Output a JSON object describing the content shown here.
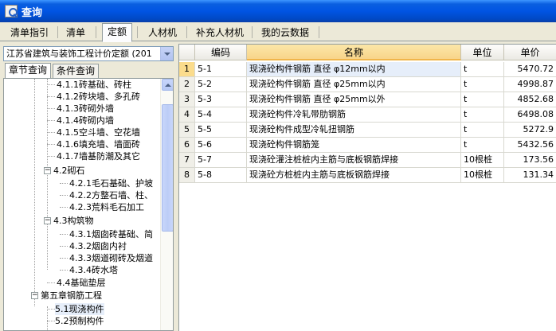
{
  "window": {
    "title": "查询"
  },
  "tabs": [
    {
      "label": "清单指引",
      "active": false
    },
    {
      "label": "清单",
      "active": false
    },
    {
      "label": "定额",
      "active": true
    },
    {
      "label": "人材机",
      "active": false
    },
    {
      "label": "补充人材机",
      "active": false
    },
    {
      "label": "我的云数据",
      "active": false
    }
  ],
  "left": {
    "library": "江苏省建筑与装饰工程计价定额 (201",
    "subtabs": [
      {
        "label": "章节查询",
        "active": true
      },
      {
        "label": "条件查询",
        "active": false
      }
    ],
    "tree": [
      {
        "label": "4.1.1砖基础、砖柱",
        "level": 3
      },
      {
        "label": "4.1.2砖块墙、多孔砖",
        "level": 3
      },
      {
        "label": "4.1.3砖砌外墙",
        "level": 3
      },
      {
        "label": "4.1.4砖砌内墙",
        "level": 3
      },
      {
        "label": "4.1.5空斗墙、空花墙",
        "level": 3
      },
      {
        "label": "4.1.6填充墙、墙面砖",
        "level": 3
      },
      {
        "label": "4.1.7墙基防潮及其它",
        "level": 3
      },
      {
        "label": "4.2砌石",
        "level": 2,
        "expander": "-"
      },
      {
        "label": "4.2.1毛石基础、护坡",
        "level": 3
      },
      {
        "label": "4.2.2方整石墙、柱、",
        "level": 3
      },
      {
        "label": "4.2.3荒料毛石加工",
        "level": 3
      },
      {
        "label": "4.3构筑物",
        "level": 2,
        "expander": "-"
      },
      {
        "label": "4.3.1烟囱砖基础、简",
        "level": 3
      },
      {
        "label": "4.3.2烟囱内衬",
        "level": 3
      },
      {
        "label": "4.3.3烟道砌砖及烟道",
        "level": 3
      },
      {
        "label": "4.3.4砖水塔",
        "level": 3
      },
      {
        "label": "4.4基础垫层",
        "level": 2
      },
      {
        "label": "第五章钢筋工程",
        "level": 1,
        "expander": "-"
      },
      {
        "label": "5.1现浇构件",
        "level": 2,
        "selected": true
      },
      {
        "label": "5.2预制构件",
        "level": 2
      }
    ]
  },
  "grid": {
    "columns": [
      "",
      "编码",
      "名称",
      "单位",
      "单价"
    ],
    "rows": [
      {
        "no": "1",
        "code": "5-1",
        "name": "现浇砼构件钢筋 直径 φ12mm以内",
        "unit": "t",
        "price": "5470.72"
      },
      {
        "no": "2",
        "code": "5-2",
        "name": "现浇砼构件钢筋 直径 φ25mm以内",
        "unit": "t",
        "price": "4998.87"
      },
      {
        "no": "3",
        "code": "5-3",
        "name": "现浇砼构件钢筋 直径 φ25mm以外",
        "unit": "t",
        "price": "4852.68"
      },
      {
        "no": "4",
        "code": "5-4",
        "name": "现浇砼构件冷轧带肋钢筋",
        "unit": "t",
        "price": "6498.08"
      },
      {
        "no": "5",
        "code": "5-5",
        "name": "现浇砼构件成型冷轧扭钢筋",
        "unit": "t",
        "price": "5272.9"
      },
      {
        "no": "6",
        "code": "5-6",
        "name": "现浇砼构件钢筋笼",
        "unit": "t",
        "price": "5432.56"
      },
      {
        "no": "7",
        "code": "5-7",
        "name": "现浇砼灌注桩桩内主筋与底板钢筋焊接",
        "unit": "10根桩",
        "price": "173.56"
      },
      {
        "no": "8",
        "code": "5-8",
        "name": "现浇砼方桩桩内主筋与底板钢筋焊接",
        "unit": "10根桩",
        "price": "131.34"
      }
    ]
  }
}
